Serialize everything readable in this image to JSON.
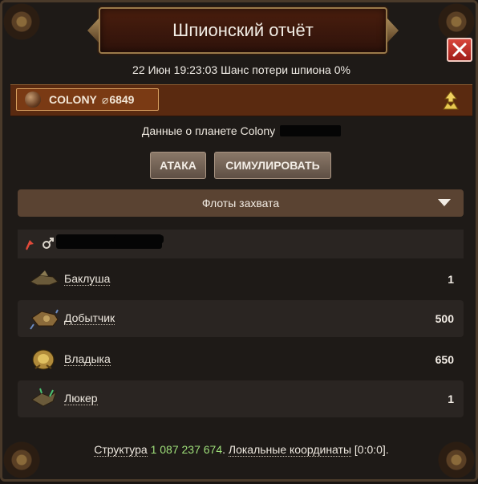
{
  "window": {
    "title": "Шпионский отчёт"
  },
  "report": {
    "info": "22 Июн 19:23:03 Шанс потери шпиона 0%"
  },
  "colony": {
    "name": "COLONY",
    "separator": "⌀",
    "coords": "6849"
  },
  "planet": {
    "data_label": "Данные о планете Colony"
  },
  "actions": {
    "attack": "АТАКА",
    "simulate": "СИМУЛИРОВАТЬ"
  },
  "fleet_section": {
    "title": "Флоты захвата"
  },
  "ships": [
    {
      "name": "Баклуша",
      "count": "1",
      "icon": "ship-scout-icon"
    },
    {
      "name": "Добытчик",
      "count": "500",
      "icon": "ship-miner-icon"
    },
    {
      "name": "Владыка",
      "count": "650",
      "icon": "ship-overlord-icon"
    },
    {
      "name": "Люкер",
      "count": "1",
      "icon": "ship-lurker-icon"
    }
  ],
  "footer": {
    "structure_label": "Структура",
    "structure_value": "1 087 237 674",
    "coords_label": "Локальные координаты",
    "coords_value": "[0:0:0]",
    "dot": "."
  },
  "colors": {
    "accent_green": "#9fe07a",
    "close_red": "#c9302c",
    "banner_brown": "#5a2a10"
  }
}
